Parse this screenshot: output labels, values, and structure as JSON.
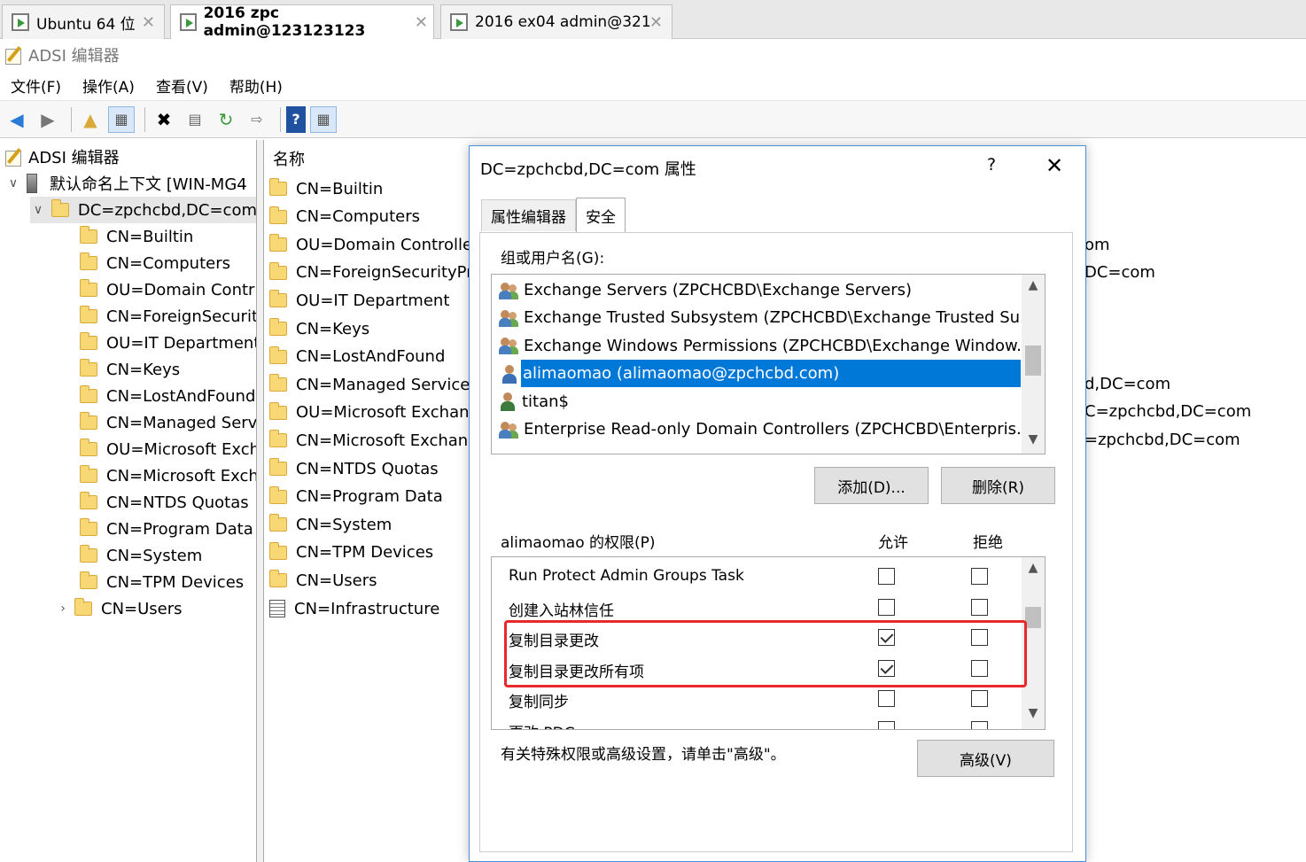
{
  "vm_tabs": [
    {
      "label": "Ubuntu 64 位",
      "active": false
    },
    {
      "label": "2016 zpc admin@123123123",
      "active": true
    },
    {
      "label": "2016 ex04 admin@321",
      "active": false
    }
  ],
  "app": {
    "title": "ADSI 编辑器"
  },
  "menu": {
    "file": "文件(F)",
    "action": "操作(A)",
    "view": "查看(V)",
    "help": "帮助(H)"
  },
  "tree": {
    "root": "ADSI 编辑器",
    "context": "默认命名上下文 [WIN-MG4",
    "domain": "DC=zpchcbd,DC=com",
    "items": [
      "CN=Builtin",
      "CN=Computers",
      "OU=Domain Contr",
      "CN=ForeignSecurit",
      "OU=IT Department",
      "CN=Keys",
      "CN=LostAndFound",
      "CN=Managed Serv",
      "OU=Microsoft Exch",
      "CN=Microsoft Exch",
      "CN=NTDS Quotas",
      "CN=Program Data",
      "CN=System",
      "CN=TPM Devices",
      "CN=Users"
    ]
  },
  "list": {
    "header": "名称",
    "items": [
      "CN=Builtin",
      "CN=Computers",
      "OU=Domain Controlle",
      "CN=ForeignSecurityPri",
      "OU=IT Department",
      "CN=Keys",
      "CN=LostAndFound",
      "CN=Managed Service",
      "OU=Microsoft Exchang",
      "CN=Microsoft Exchang",
      "CN=NTDS Quotas",
      "CN=Program Data",
      "CN=System",
      "CN=TPM Devices",
      "CN=Users",
      "CN=Infrastructure"
    ],
    "right_fragments": [
      "om",
      "DC=com",
      "d,DC=com",
      "C=zpchcbd,DC=com",
      "=zpchcbd,DC=com"
    ]
  },
  "dialog": {
    "title": "DC=zpchcbd,DC=com 属性",
    "help": "?",
    "close": "✕",
    "tabs": [
      "属性编辑器",
      "安全"
    ],
    "group_label": "组或用户名(G):",
    "groups": [
      {
        "name": "Exchange Servers (ZPCHCBD\\Exchange Servers)",
        "kind": "group"
      },
      {
        "name": "Exchange Trusted Subsystem (ZPCHCBD\\Exchange Trusted Su...",
        "kind": "group"
      },
      {
        "name": "Exchange Windows Permissions (ZPCHCBD\\Exchange Window...",
        "kind": "group"
      },
      {
        "name": "alimaomao (alimaomao@zpchcbd.com)",
        "kind": "user-blue",
        "selected": true
      },
      {
        "name": "titan$",
        "kind": "user"
      },
      {
        "name": "Enterprise Read-only Domain Controllers (ZPCHCBD\\Enterpris...",
        "kind": "group"
      }
    ],
    "add_button": "添加(D)...",
    "remove_button": "删除(R)",
    "perm_label": "alimaomao 的权限(P)",
    "allow_header": "允许",
    "deny_header": "拒绝",
    "permissions": [
      {
        "name": "Run Protect Admin Groups Task",
        "allow": false,
        "deny": false
      },
      {
        "name": "创建入站林信任",
        "allow": false,
        "deny": false
      },
      {
        "name": "复制目录更改",
        "allow": true,
        "deny": false
      },
      {
        "name": "复制目录更改所有项",
        "allow": true,
        "deny": false
      },
      {
        "name": "复制同步",
        "allow": false,
        "deny": false
      },
      {
        "name": "更改 PDC",
        "allow": false,
        "deny": false
      }
    ],
    "advanced_note": "有关特殊权限或高级设置，请单击\"高级\"。",
    "advanced_button": "高级(V)"
  },
  "colors": {
    "selection": "#0078d7",
    "highlight_box": "#e8282b",
    "dialog_border": "#4a90d9"
  }
}
